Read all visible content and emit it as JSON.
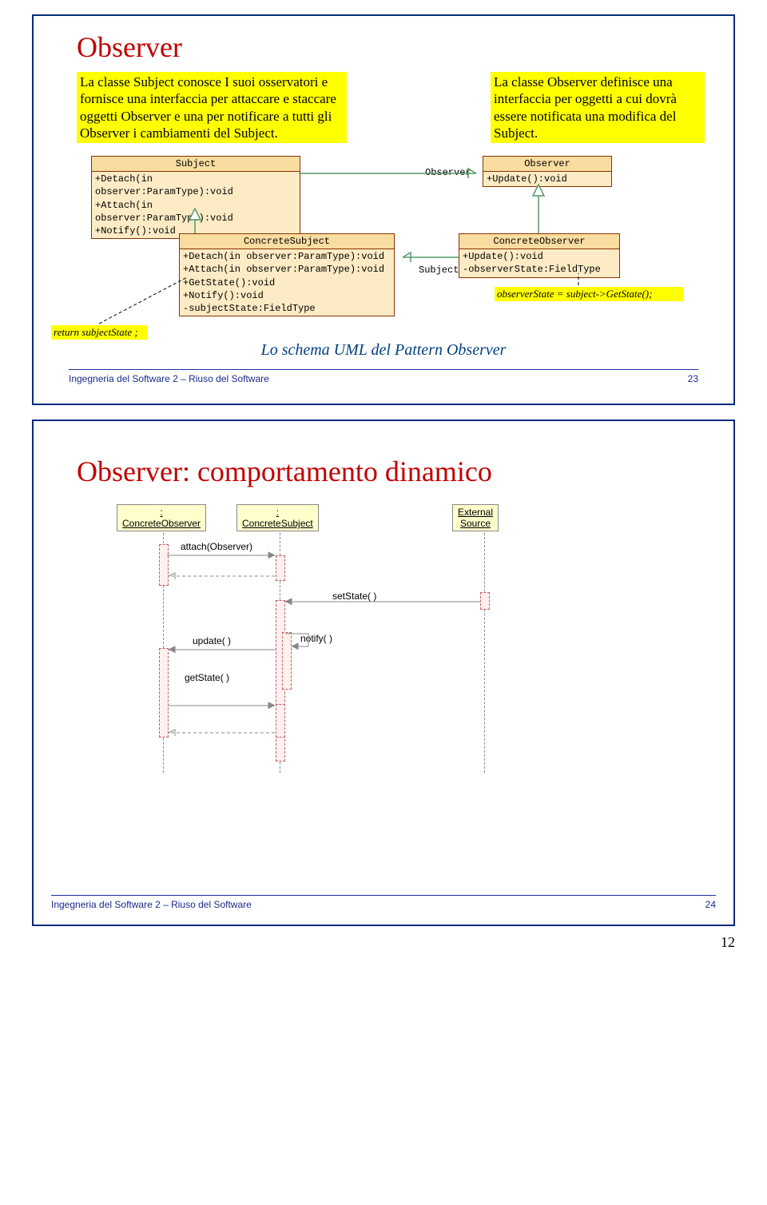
{
  "page_number": "12",
  "slide1": {
    "title": "Observer",
    "note_left": "La classe Subject conosce I suoi osservatori e fornisce una interfaccia per attaccare e staccare oggetti Observer e una per notificare a tutti gli Observer i cambiamenti del Subject.",
    "note_right": "La classe Observer definisce una interfaccia per oggetti a cui dovrà essere notificata una modifica del Subject.",
    "uml": {
      "subject": {
        "name": "Subject",
        "ops": [
          "+Detach(in observer:ParamType):void",
          "+Attach(in observer:ParamType):void",
          "+Notify():void"
        ]
      },
      "observer": {
        "name": "Observer",
        "ops": [
          "+Update():void"
        ]
      },
      "assoc_label": "Observer",
      "concrete_subject": {
        "name": "ConcreteSubject",
        "ops": [
          "+Detach(in observer:ParamType):void",
          "+Attach(in observer:ParamType):void",
          "+GetState():void",
          "+Notify():void",
          "-subjectState:FieldType"
        ]
      },
      "concrete_observer": {
        "name": "ConcreteObserver",
        "ops": [
          "+Update():void",
          "-observerState:FieldType"
        ]
      },
      "assoc_label2": "Subject",
      "return_note": "return subjectState ;",
      "obs_note": "observerState = subject->GetState();"
    },
    "caption": "Lo schema UML del Pattern Observer",
    "footer_text": "Ingegneria del Software 2 – Riuso del Software",
    "footer_num": "23"
  },
  "slide2": {
    "title": "Observer: comportamento dinamico",
    "seq": {
      "obj1": "ConcreteObserver",
      "obj1_prefix": ":",
      "obj2": "ConcreteSubject",
      "obj2_prefix": ":",
      "obj3_l1": "External",
      "obj3_l2": "Source",
      "msg_attach": "attach(Observer)",
      "msg_setstate": "setState( )",
      "msg_update": "update( )",
      "msg_notify": "notify( )",
      "msg_getstate": "getState( )"
    },
    "footer_text": "Ingegneria del Software 2 – Riuso del Software",
    "footer_num": "24"
  }
}
